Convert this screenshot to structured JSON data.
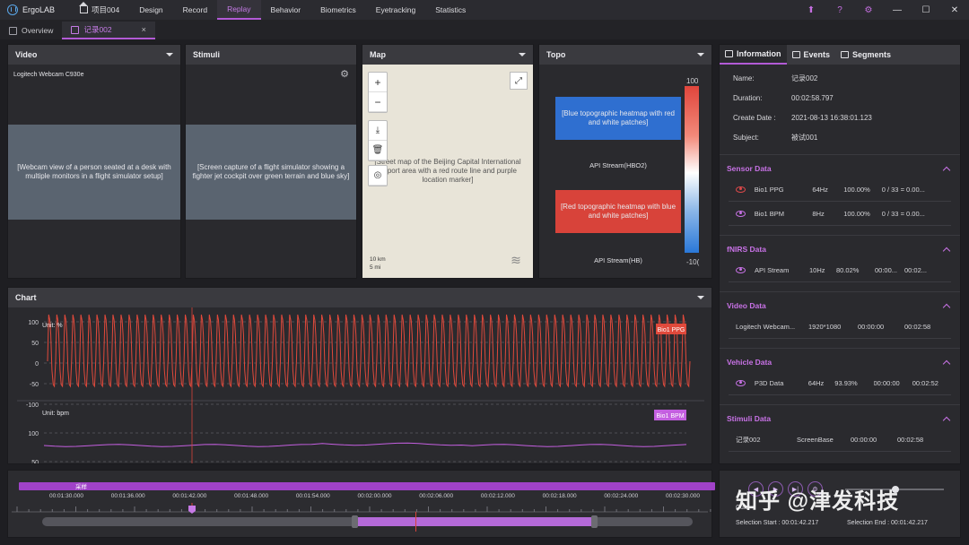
{
  "app": {
    "name": "ErgoLAB",
    "menu": [
      {
        "label": "项目004",
        "icon": "home-icon"
      },
      {
        "label": "Design"
      },
      {
        "label": "Record"
      },
      {
        "label": "Replay",
        "active": true
      },
      {
        "label": "Behavior"
      },
      {
        "label": "Biometrics"
      },
      {
        "label": "Eyetracking"
      },
      {
        "label": "Statistics"
      }
    ],
    "accent": "#b25ad6"
  },
  "window_controls": [
    {
      "icon": "upload-arrow-icon",
      "glyph": "⬆"
    },
    {
      "icon": "help-icon",
      "glyph": "?"
    },
    {
      "icon": "settings-gear-icon",
      "glyph": "⚙"
    },
    {
      "icon": "minimize-icon",
      "glyph": "—"
    },
    {
      "icon": "maximize-icon",
      "glyph": "☐"
    },
    {
      "icon": "close-icon",
      "glyph": "✕"
    }
  ],
  "doc_tabs": [
    {
      "label": "Overview",
      "active": false
    },
    {
      "label": "记录002",
      "active": true,
      "close": "×"
    }
  ],
  "panels": {
    "video": {
      "title": "Video",
      "source": "Logitech Webcam C930e",
      "image": "[Webcam view of a person seated at a desk with multiple monitors in a flight simulator setup]"
    },
    "stimuli": {
      "title": "Stimuli",
      "image": "[Screen capture of a flight simulator showing a fighter jet cockpit over green terrain and blue sky]"
    },
    "map": {
      "title": "Map",
      "image": "[Street map of the Beijing Capital International Airport area with a red route line and purple location marker]",
      "scale": [
        "10 km",
        "5 mi"
      ]
    },
    "topo": {
      "title": "Topo",
      "items": [
        {
          "label": "API Stream(HBO2)",
          "image": "[Blue topographic heatmap with red and white patches]"
        },
        {
          "label": "API Stream(HB)",
          "image": "[Red topographic heatmap with blue and white patches]"
        }
      ],
      "scale_max": "100",
      "scale_min": "-10("
    }
  },
  "chart": {
    "title": "Chart",
    "upper": {
      "unit": "Unit: %",
      "legend": "Bio1 PPG",
      "color": "#e0493b"
    },
    "lower": {
      "unit": "Unit: bpm",
      "legend": "Bio1 BPM",
      "color": "#c45fe0"
    }
  },
  "chart_data": {
    "type": "line",
    "series": [
      {
        "name": "Bio1 PPG",
        "unit": "%",
        "pattern": "periodic pulse, approx. -50 to 100"
      },
      {
        "name": "Bio1 BPM",
        "unit": "bpm",
        "pattern": "nearly flat around 60"
      }
    ],
    "upper_axis_ticks": [
      "100",
      "50",
      "0",
      "-50",
      "-100"
    ],
    "lower_axis_ticks": [
      "100",
      "50"
    ]
  },
  "timeline": {
    "bar_label": "采样",
    "ticks": [
      "00:01:30.000",
      "00:01:36.000",
      "00:01:42.000",
      "00:01:48.000",
      "00:01:54.000",
      "00:02:00.000",
      "00:02:06.000",
      "00:02:12.000",
      "00:02:18.000",
      "00:02:24.000",
      "00:02:30.000"
    ]
  },
  "playback": {
    "buttons": [
      {
        "icon": "step-back-icon",
        "glyph": "◀"
      },
      {
        "icon": "play-icon",
        "glyph": "▶"
      },
      {
        "icon": "step-forward-icon",
        "glyph": "▶|"
      },
      {
        "icon": "settings-icon",
        "glyph": "⚙"
      }
    ],
    "current_time_fragment": "Curr",
    "selection_start": "Selection Start : 00:01:42.217",
    "selection_end": "Selection End : 00:01:42.217",
    "watermark": "知乎 @津发科技"
  },
  "info": {
    "tabs": [
      {
        "label": "Information",
        "active": true
      },
      {
        "label": "Events"
      },
      {
        "label": "Segments"
      }
    ],
    "fields": [
      {
        "key": "Name:",
        "value": "记录002"
      },
      {
        "key": "Duration:",
        "value": "00:02:58.797"
      },
      {
        "key": "Create Date :",
        "value": "2021-08-13 16:38:01.123"
      },
      {
        "key": "Subject:",
        "value": "被试001"
      }
    ],
    "sections": [
      {
        "title": "Sensor Data",
        "rows": [
          {
            "eye": "red",
            "cells": [
              "Bio1 PPG",
              "64Hz",
              "100.00%",
              "0 / 33 = 0.00..."
            ]
          },
          {
            "eye": "purple",
            "cells": [
              "Bio1 BPM",
              "8Hz",
              "100.00%",
              "0 / 33 = 0.00..."
            ]
          }
        ]
      },
      {
        "title": "fNIRS Data",
        "rows": [
          {
            "eye": "purple",
            "cells": [
              "API Stream",
              "10Hz",
              "80.02%",
              "00:00...",
              "00:02..."
            ]
          }
        ]
      },
      {
        "title": "Video Data",
        "rows": [
          {
            "eye": "none",
            "cells": [
              "Logitech Webcam...",
              "1920*1080",
              "00:00:00",
              "00:02:58"
            ]
          }
        ]
      },
      {
        "title": "Vehicle Data",
        "rows": [
          {
            "eye": "purple",
            "cells": [
              "P3D Data",
              "64Hz",
              "93.93%",
              "00:00:00",
              "00:02:52"
            ]
          }
        ]
      },
      {
        "title": "Stimuli Data",
        "rows": [
          {
            "eye": "none",
            "cells": [
              "记录002",
              "ScreenBase",
              "00:00:00",
              "00:02:58"
            ]
          }
        ]
      }
    ]
  }
}
